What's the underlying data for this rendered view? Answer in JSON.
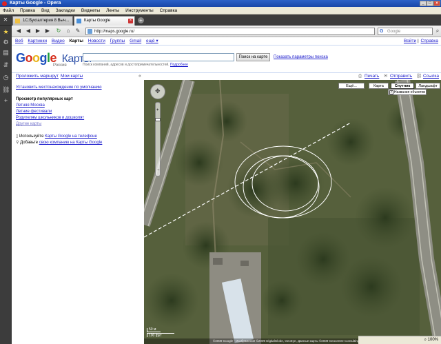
{
  "window": {
    "title": "Карты Google - Opera"
  },
  "menu": [
    "Файл",
    "Правка",
    "Вид",
    "Закладки",
    "Виджеты",
    "Ленты",
    "Инструменты",
    "Справка"
  ],
  "tabs": [
    {
      "label": "1С:Бухгалтерия 8 Выч..."
    },
    {
      "label": "Карты Google"
    }
  ],
  "address": {
    "url": "http://maps.google.ru/",
    "search_placeholder": "Google"
  },
  "gbar": {
    "links": [
      "Веб",
      "Картинки",
      "Видео",
      "Карты",
      "Новости",
      "Группы",
      "Gmail",
      "ещё ▾"
    ],
    "account": "Войти",
    "help": "Справка"
  },
  "logo": {
    "word": "Google",
    "product": "Карты",
    "region": "Россия"
  },
  "search": {
    "hint": "Поиск компаний, адресов и достопримечательностей.",
    "hint_link": "Подробнее",
    "button": "Поиск на карте",
    "options": "Показать параметры поиска"
  },
  "toolrow": {
    "route": "Проложить маршрут",
    "my_maps": "Мои карты",
    "print": "Печать",
    "send": "Отправить",
    "link": "Ссылка"
  },
  "sidebar": {
    "set_location": "Установить местонахождение по умолчанию",
    "popular_title": "Просмотр популярных карт",
    "popular": [
      "Летняя Москва",
      "Летние фестивали",
      "Родителям школьников и дошколят"
    ],
    "other_maps": "Другие карты",
    "mobile_text": "Используйте",
    "mobile_link": "Карты Google на телефоне",
    "add_text": "Добавьте",
    "add_link": "свою компанию на Карты Google"
  },
  "map": {
    "types": [
      "Ещё...",
      "Карта",
      "Спутник",
      "Ландшафт"
    ],
    "selected_type": "Спутник",
    "overlay_label": "Названия объектов",
    "scale_metric": "50 м",
    "scale_imperial": "100 фут",
    "copyright": "©2009 Google - Изображения ©2009 DigitalGlobe, GeoEye, Данные карты ©2009 Geocentre Consulting - Условия использования"
  },
  "status": {
    "zoom": "100%"
  },
  "colors": {
    "accent": "#1a1acc",
    "map_bg": "#4e5a37",
    "titlebar": "#2b62c8"
  }
}
